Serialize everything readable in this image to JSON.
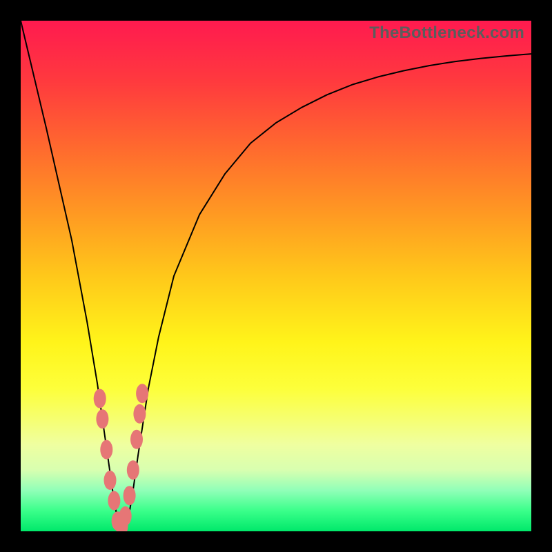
{
  "watermark": "TheBottleneck.com",
  "colors": {
    "frame": "#000000",
    "curve": "#000000",
    "marker": "#e67676",
    "gradient_top": "#ff1a4f",
    "gradient_bottom": "#00e86a"
  },
  "chart_data": {
    "type": "line",
    "title": "",
    "xlabel": "",
    "ylabel": "",
    "xlim": [
      0,
      100
    ],
    "ylim": [
      0,
      100
    ],
    "grid": false,
    "legend": false,
    "x": [
      0,
      5,
      10,
      13,
      15,
      17,
      18,
      19,
      20,
      21,
      22,
      23,
      25,
      27,
      30,
      35,
      40,
      45,
      50,
      55,
      60,
      65,
      70,
      75,
      80,
      85,
      90,
      95,
      100
    ],
    "series": [
      {
        "name": "bottleneck",
        "values": [
          100,
          79,
          57,
          41,
          29,
          15,
          8,
          2,
          0,
          2,
          8,
          15,
          28,
          38,
          50,
          62,
          70,
          76,
          80,
          83,
          85.5,
          87.5,
          89,
          90.2,
          91.2,
          92,
          92.6,
          93.1,
          93.5
        ]
      }
    ],
    "markers": {
      "comment": "scatter points near valley; same x-axis scale",
      "x": [
        15.5,
        16.0,
        16.8,
        17.5,
        18.3,
        19.0,
        19.8,
        20.5,
        21.3,
        22.0,
        22.7,
        23.3,
        23.8
      ],
      "y": [
        26,
        22,
        16,
        10,
        6,
        2,
        1,
        3,
        7,
        12,
        18,
        23,
        27
      ]
    }
  }
}
